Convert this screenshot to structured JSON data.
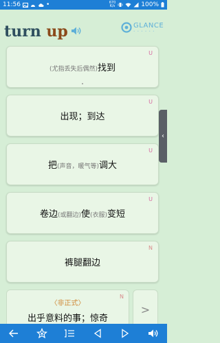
{
  "status": {
    "time": "11:56",
    "net_top": "670",
    "net_bottom": "K/s",
    "battery": "100%"
  },
  "header": {
    "word_first": "turn",
    "word_second": "up",
    "logo": "GLANCE"
  },
  "cards": [
    {
      "prefix": "(尤指丢失后偶然)",
      "main": "找到",
      "tag": "U"
    },
    {
      "main": "出现；到达",
      "tag": "U"
    },
    {
      "main1": "把",
      "note": "(声音，暖气等)",
      "main2": "调大",
      "tag": "U"
    },
    {
      "main1": "卷边",
      "note1": "(或翻边)",
      "main2": "使",
      "note2": "(衣服)",
      "main3": "变短",
      "tag": "U"
    },
    {
      "main": "裤腿翻边",
      "tag": "N"
    }
  ],
  "card6": {
    "informal": "〈非正式〉",
    "meaning": "出乎意料的事；惊奇",
    "tag": "N"
  },
  "controls": {
    "side_handle": "‹",
    "next": ">"
  },
  "colors": {
    "status_bar": "#1e7fd6",
    "background": "#d6eed6",
    "card": "#e9f6e6"
  }
}
